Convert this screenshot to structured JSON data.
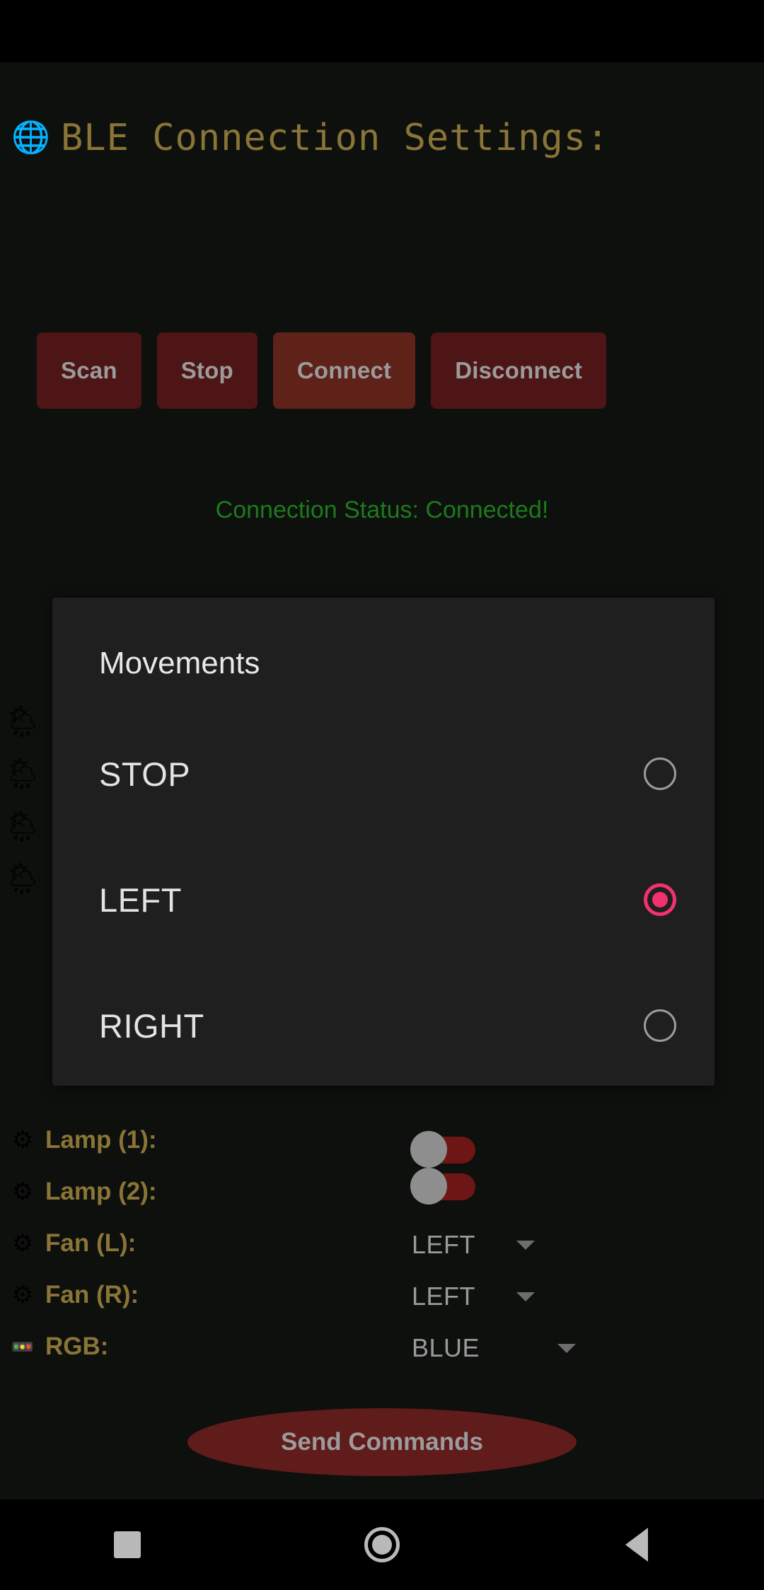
{
  "header": {
    "globe_icon": "🌐",
    "title": "BLE Connection Settings:"
  },
  "connection_buttons": [
    {
      "label": "Scan",
      "icon_name": "scan-button",
      "active": false
    },
    {
      "label": "Stop",
      "icon_name": "stop-button",
      "active": false
    },
    {
      "label": "Connect",
      "icon_name": "connect-button",
      "active": true
    },
    {
      "label": "Disconnect",
      "icon_name": "disconnect-button",
      "active": false
    }
  ],
  "connection_status": "Connection Status: Connected!",
  "background_icons": [
    {
      "glyph": "🌦"
    },
    {
      "glyph": "🌦"
    },
    {
      "glyph": "🌦"
    },
    {
      "glyph": "🌦"
    }
  ],
  "dialog": {
    "title": "Movements",
    "options": [
      {
        "label": "STOP",
        "selected": false
      },
      {
        "label": "LEFT",
        "selected": true
      },
      {
        "label": "RIGHT",
        "selected": false
      }
    ]
  },
  "controls": {
    "lamp1": {
      "icon": "⚙",
      "label": "Lamp (1):",
      "type": "toggle",
      "value": "off"
    },
    "lamp2": {
      "icon": "⚙",
      "label": "Lamp (2):",
      "type": "toggle",
      "value": "off"
    },
    "fan_l": {
      "icon": "⚙",
      "label": "Fan (L):",
      "type": "dropdown",
      "value": "LEFT"
    },
    "fan_r": {
      "icon": "⚙",
      "label": "Fan (R):",
      "type": "dropdown",
      "value": "LEFT"
    },
    "rgb": {
      "icon": "🚥",
      "label": "RGB:",
      "type": "dropdown",
      "value": "BLUE"
    }
  },
  "send_button_label": "Send Commands",
  "nav_bar": {
    "recents": "recents-square-icon",
    "home": "home-circle-icon",
    "back": "back-triangle-icon"
  },
  "colors": {
    "accent_gold": "#8a7436",
    "button_red": "#4d1515",
    "button_red_active": "#5e2219",
    "status_green": "#1d7a1d",
    "radio_selected_pink": "#f2326d",
    "dialog_bg": "#1f1f1f",
    "app_bg": "#0d100d"
  }
}
